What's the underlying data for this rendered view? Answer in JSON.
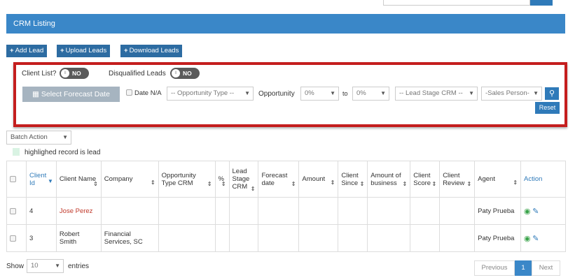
{
  "header": {
    "title": "CRM Listing"
  },
  "toolbar": {
    "add_lead": "Add Lead",
    "upload_leads": "Upload Leads",
    "download_leads": "Download Leads"
  },
  "filters": {
    "client_list_label": "Client List?",
    "client_list_toggle": "NO",
    "disqualified_label": "Disqualified Leads",
    "disqualified_toggle": "NO",
    "toggle_knob": "II",
    "forecast_button": "Select Forecast Date",
    "date_na_label": "Date N/A",
    "opportunity_type": "-- Opportunity Type --",
    "opportunity_label": "Opportunity",
    "opportunity_from": "0%",
    "to_label": "to",
    "opportunity_to": "0%",
    "lead_stage": "-- Lead Stage CRM --",
    "sales_person": "-Sales Person-",
    "reset": "Reset"
  },
  "batch_action": "Batch Action",
  "legend": "highlighed record is lead",
  "table": {
    "columns": [
      "Client Id",
      "Client Name",
      "Company",
      "Opportunity Type CRM",
      "%",
      "Lead Stage CRM",
      "Forecast date",
      "Amount",
      "Client Since",
      "Amount of business",
      "Client Score",
      "Client Review",
      "Agent",
      "Action"
    ],
    "rows": [
      {
        "client_id": "4",
        "client_name": "Jose Perez",
        "company": "",
        "agent": "Paty Prueba"
      },
      {
        "client_id": "3",
        "client_name": "Robert Smith",
        "company": "Financial Services, SC",
        "agent": "Paty Prueba"
      }
    ]
  },
  "footer": {
    "show_label": "Show",
    "entries_value": "10",
    "entries_label": "entries",
    "previous": "Previous",
    "page": "1",
    "next": "Next"
  },
  "colors": {
    "header_blue": "#3a87c8",
    "button_blue": "#2d6ca2",
    "highlight_red": "#c41e1e",
    "lead_name_red": "#c0392b",
    "legend_green": "#d9f3e3"
  },
  "icons": [
    "plus-icon",
    "calendar-icon",
    "search-icon",
    "sort-icon",
    "eye-icon",
    "edit-icon",
    "caret-down-icon"
  ]
}
